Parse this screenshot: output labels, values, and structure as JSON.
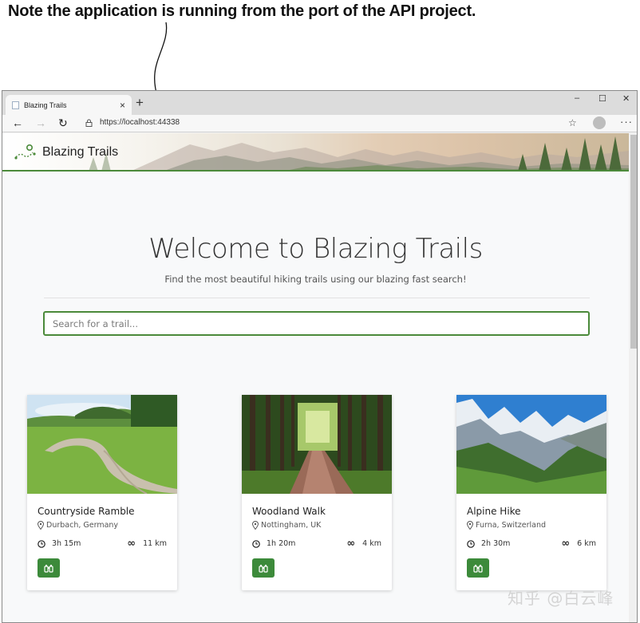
{
  "annotation": {
    "text": "Note the application is running from the port of the API project."
  },
  "browser": {
    "tab_title": "Blazing Trails",
    "tab_close": "×",
    "new_tab": "+",
    "window_minimize": "–",
    "window_maximize": "☐",
    "window_close": "✕",
    "back": "←",
    "forward": "→",
    "reload": "↻",
    "url": "https://localhost:44338",
    "favorites": "☆",
    "menu": "···"
  },
  "site": {
    "brand": "Blazing Trails",
    "hero_title": "Welcome to Blazing Trails",
    "hero_subtitle": "Find the most beautiful hiking trails using our blazing fast search!",
    "search_placeholder": "Search for a trail..."
  },
  "trails": [
    {
      "name": "Countryside Ramble",
      "location": "Durbach, Germany",
      "time": "3h 15m",
      "distance": "11 km"
    },
    {
      "name": "Woodland Walk",
      "location": "Nottingham, UK",
      "time": "1h 20m",
      "distance": "4 km"
    },
    {
      "name": "Alpine Hike",
      "location": "Furna, Switzerland",
      "time": "2h 30m",
      "distance": "6 km"
    }
  ],
  "watermark": "知乎 @白云峰",
  "colors": {
    "accent": "#3c8a3a",
    "header_border": "#4b8a3a",
    "page_bg": "#f8f9fa"
  },
  "icons": {
    "location": "map-pin-icon",
    "time": "clock-icon",
    "distance": "infinity-icon",
    "view": "binoculars-icon"
  }
}
